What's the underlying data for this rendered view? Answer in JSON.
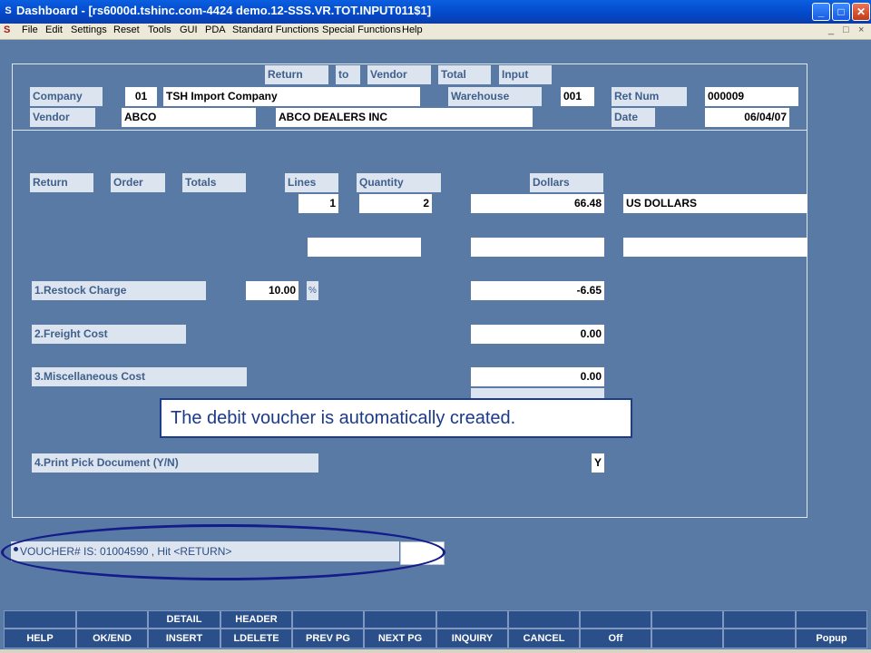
{
  "window": {
    "title": "Dashboard - [rs6000d.tshinc.com-4424 demo.12-SSS.VR.TOT.INPUT011$1]",
    "app_icon": "S",
    "controls": {
      "minimize": "_",
      "maximize": "□",
      "close": "✕"
    }
  },
  "menu": {
    "items": [
      "File",
      "Edit",
      "Settings",
      "Reset",
      "Tools",
      "GUI",
      "PDA",
      "Standard Functions",
      "Special Functions",
      "Help"
    ],
    "mdi_controls": [
      "_",
      "□",
      "×"
    ]
  },
  "header": {
    "title_words": [
      "Return",
      "to",
      "Vendor",
      "Total",
      "Input"
    ],
    "company_label": "Company",
    "company_code": "01",
    "company_name": "TSH Import Company",
    "warehouse_label": "Warehouse",
    "warehouse_value": "001",
    "ret_num_label": "Ret Num",
    "ret_num_value": "000009",
    "vendor_label": "Vendor",
    "vendor_code": "ABCO",
    "vendor_name": "ABCO DEALERS INC",
    "date_label": "Date",
    "date_value": "06/04/07"
  },
  "totals": {
    "return_label": "Return",
    "order_label": "Order",
    "totals_label": "Totals",
    "lines_label": "Lines",
    "quantity_label": "Quantity",
    "dollars_label": "Dollars",
    "lines_value": "1",
    "quantity_value": "2",
    "dollars_value": "66.48",
    "currency_value": "US DOLLARS"
  },
  "charges": {
    "restock_label": "1.Restock Charge",
    "restock_pct": "10.00",
    "pct_symbol": "%",
    "restock_amount": "-6.65",
    "freight_label": "2.Freight Cost",
    "freight_amount": "0.00",
    "misc_label": "3.Miscellaneous Cost",
    "misc_amount": "0.00",
    "print_pick_label": "4.Print Pick Document (Y/N)",
    "print_pick_value": "Y"
  },
  "callout": "The debit voucher is automatically created.",
  "status_message": "VOUCHER# IS: 01004590 , Hit <RETURN>",
  "function_keys": {
    "top": [
      "",
      "",
      "DETAIL",
      "HEADER",
      "",
      "",
      "",
      "",
      "",
      "",
      "",
      ""
    ],
    "bottom": [
      "HELP",
      "OK/END",
      "INSERT",
      "LDELETE",
      "PREV PG",
      "NEXT PG",
      "INQUIRY",
      "CANCEL",
      "Off",
      "",
      "",
      "Popup"
    ]
  }
}
